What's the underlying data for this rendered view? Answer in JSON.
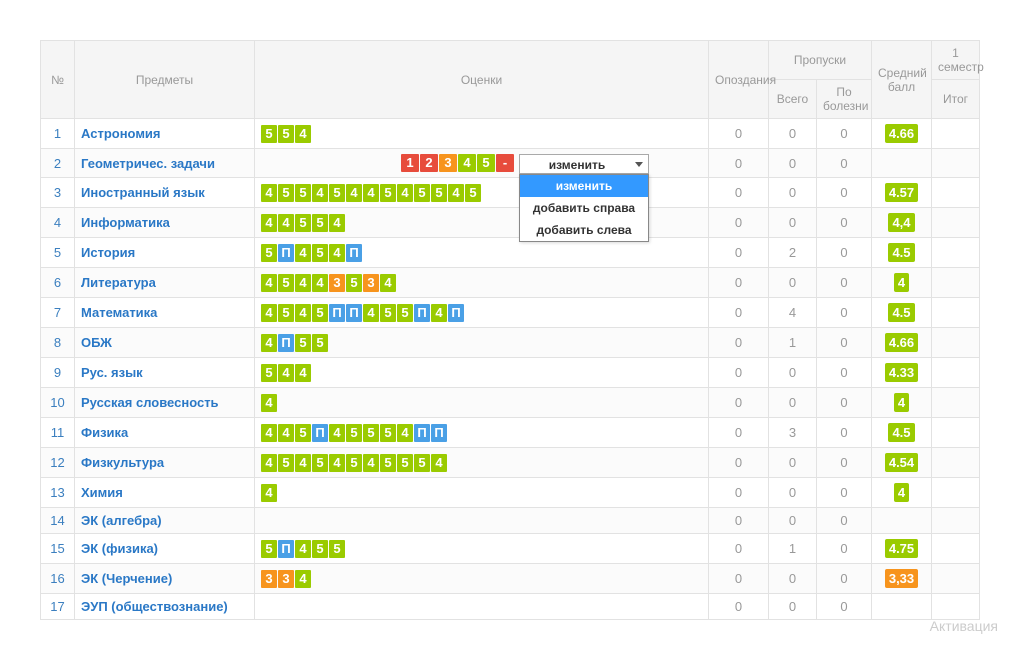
{
  "headers": {
    "num": "№",
    "subjects": "Предметы",
    "marks": "Оценки",
    "late": "Опоздания",
    "absences": "Пропуски",
    "abs_total": "Всего",
    "abs_ill": "По болезни",
    "avg": "Средний балл",
    "itog_group": "1 семестр",
    "itog": "Итог"
  },
  "scale": [
    "1",
    "2",
    "3",
    "4",
    "5",
    "-"
  ],
  "scale_colors": [
    "r",
    "r",
    "o",
    "g",
    "g",
    "r"
  ],
  "dropdown": {
    "selected": "изменить",
    "options": [
      "изменить",
      "добавить справа",
      "добавить слева"
    ],
    "highlighted": 0
  },
  "rows": [
    {
      "n": 1,
      "subject": "Астрономия",
      "marks": [
        [
          "5",
          "g"
        ],
        [
          "5",
          "g"
        ],
        [
          "4",
          "g"
        ]
      ],
      "late": 0,
      "abs": 0,
      "ill": 0,
      "avg": "4.66",
      "avg_c": "g"
    },
    {
      "n": 2,
      "subject": "Геометричес. задачи",
      "marks": [],
      "late": 0,
      "abs": 0,
      "ill": 0,
      "avg": "",
      "avg_c": ""
    },
    {
      "n": 3,
      "subject": "Иностранный язык",
      "marks": [
        [
          "4",
          "g"
        ],
        [
          "5",
          "g"
        ],
        [
          "5",
          "g"
        ],
        [
          "4",
          "g"
        ],
        [
          "5",
          "g"
        ],
        [
          "4",
          "g"
        ],
        [
          "4",
          "g"
        ],
        [
          "5",
          "g"
        ],
        [
          "4",
          "g"
        ],
        [
          "5",
          "g"
        ],
        [
          "5",
          "g"
        ],
        [
          "4",
          "g"
        ],
        [
          "5",
          "g"
        ]
      ],
      "late": 0,
      "abs": 0,
      "ill": 0,
      "avg": "4.57",
      "avg_c": "g"
    },
    {
      "n": 4,
      "subject": "Информатика",
      "marks": [
        [
          "4",
          "g"
        ],
        [
          "4",
          "g"
        ],
        [
          "5",
          "g"
        ],
        [
          "5",
          "g"
        ],
        [
          "4",
          "g"
        ]
      ],
      "late": 0,
      "abs": 0,
      "ill": 0,
      "avg": "4,4",
      "avg_c": "g"
    },
    {
      "n": 5,
      "subject": "История",
      "marks": [
        [
          "5",
          "g"
        ],
        [
          "П",
          "b"
        ],
        [
          "4",
          "g"
        ],
        [
          "5",
          "g"
        ],
        [
          "4",
          "g"
        ],
        [
          "П",
          "b"
        ]
      ],
      "late": 0,
      "abs": 2,
      "ill": 0,
      "avg": "4.5",
      "avg_c": "g"
    },
    {
      "n": 6,
      "subject": "Литература",
      "marks": [
        [
          "4",
          "g"
        ],
        [
          "5",
          "g"
        ],
        [
          "4",
          "g"
        ],
        [
          "4",
          "g"
        ],
        [
          "3",
          "o"
        ],
        [
          "5",
          "g"
        ],
        [
          "3",
          "o"
        ],
        [
          "4",
          "g"
        ]
      ],
      "late": 0,
      "abs": 0,
      "ill": 0,
      "avg": "4",
      "avg_c": "g"
    },
    {
      "n": 7,
      "subject": "Математика",
      "marks": [
        [
          "4",
          "g"
        ],
        [
          "5",
          "g"
        ],
        [
          "4",
          "g"
        ],
        [
          "5",
          "g"
        ],
        [
          "П",
          "b"
        ],
        [
          "П",
          "b"
        ],
        [
          "4",
          "g"
        ],
        [
          "5",
          "g"
        ],
        [
          "5",
          "g"
        ],
        [
          "П",
          "b"
        ],
        [
          "4",
          "g"
        ],
        [
          "П",
          "b"
        ]
      ],
      "late": 0,
      "abs": 4,
      "ill": 0,
      "avg": "4.5",
      "avg_c": "g"
    },
    {
      "n": 8,
      "subject": "ОБЖ",
      "marks": [
        [
          "4",
          "g"
        ],
        [
          "П",
          "b"
        ],
        [
          "5",
          "g"
        ],
        [
          "5",
          "g"
        ]
      ],
      "late": 0,
      "abs": 1,
      "ill": 0,
      "avg": "4.66",
      "avg_c": "g"
    },
    {
      "n": 9,
      "subject": "Рус. язык",
      "marks": [
        [
          "5",
          "g"
        ],
        [
          "4",
          "g"
        ],
        [
          "4",
          "g"
        ]
      ],
      "late": 0,
      "abs": 0,
      "ill": 0,
      "avg": "4.33",
      "avg_c": "g"
    },
    {
      "n": 10,
      "subject": "Русская словесность",
      "marks": [
        [
          "4",
          "g"
        ]
      ],
      "late": 0,
      "abs": 0,
      "ill": 0,
      "avg": "4",
      "avg_c": "g"
    },
    {
      "n": 11,
      "subject": "Физика",
      "marks": [
        [
          "4",
          "g"
        ],
        [
          "4",
          "g"
        ],
        [
          "5",
          "g"
        ],
        [
          "П",
          "b"
        ],
        [
          "4",
          "g"
        ],
        [
          "5",
          "g"
        ],
        [
          "5",
          "g"
        ],
        [
          "5",
          "g"
        ],
        [
          "4",
          "g"
        ],
        [
          "П",
          "b"
        ],
        [
          "П",
          "b"
        ]
      ],
      "late": 0,
      "abs": 3,
      "ill": 0,
      "avg": "4.5",
      "avg_c": "g"
    },
    {
      "n": 12,
      "subject": "Физкультура",
      "marks": [
        [
          "4",
          "g"
        ],
        [
          "5",
          "g"
        ],
        [
          "4",
          "g"
        ],
        [
          "5",
          "g"
        ],
        [
          "4",
          "g"
        ],
        [
          "5",
          "g"
        ],
        [
          "4",
          "g"
        ],
        [
          "5",
          "g"
        ],
        [
          "5",
          "g"
        ],
        [
          "5",
          "g"
        ],
        [
          "4",
          "g"
        ]
      ],
      "late": 0,
      "abs": 0,
      "ill": 0,
      "avg": "4.54",
      "avg_c": "g"
    },
    {
      "n": 13,
      "subject": "Химия",
      "marks": [
        [
          "4",
          "g"
        ]
      ],
      "late": 0,
      "abs": 0,
      "ill": 0,
      "avg": "4",
      "avg_c": "g"
    },
    {
      "n": 14,
      "subject": "ЭК (алгебра)",
      "marks": [],
      "late": 0,
      "abs": 0,
      "ill": 0,
      "avg": "",
      "avg_c": ""
    },
    {
      "n": 15,
      "subject": "ЭК (физика)",
      "marks": [
        [
          "5",
          "g"
        ],
        [
          "П",
          "b"
        ],
        [
          "4",
          "g"
        ],
        [
          "5",
          "g"
        ],
        [
          "5",
          "g"
        ]
      ],
      "late": 0,
      "abs": 1,
      "ill": 0,
      "avg": "4.75",
      "avg_c": "g"
    },
    {
      "n": 16,
      "subject": "ЭК (Черчение)",
      "marks": [
        [
          "3",
          "o"
        ],
        [
          "3",
          "o"
        ],
        [
          "4",
          "g"
        ]
      ],
      "late": 0,
      "abs": 0,
      "ill": 0,
      "avg": "3,33",
      "avg_c": "o"
    },
    {
      "n": 17,
      "subject": "ЭУП (обществознание)",
      "marks": [],
      "late": 0,
      "abs": 0,
      "ill": 0,
      "avg": "",
      "avg_c": ""
    }
  ],
  "watermark": "Активация"
}
